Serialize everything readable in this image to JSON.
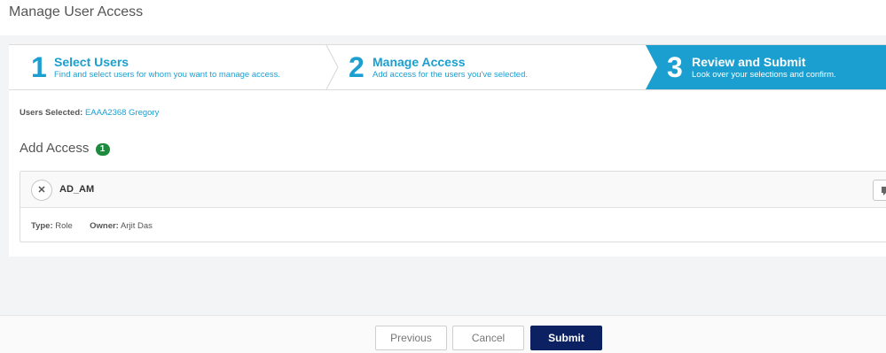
{
  "page": {
    "title": "Manage User Access"
  },
  "wizard": {
    "steps": [
      {
        "number": "1",
        "title": "Select Users",
        "description": "Find and select users for whom you want to manage access."
      },
      {
        "number": "2",
        "title": "Manage Access",
        "description": "Add access for the users you've selected."
      },
      {
        "number": "3",
        "title": "Review and Submit",
        "description": "Look over your selections and confirm."
      }
    ],
    "active_step": 3
  },
  "selection": {
    "label": "Users Selected:",
    "value": "EAAA2368 Gregory"
  },
  "add_access": {
    "heading": "Add Access",
    "count": "1",
    "items": [
      {
        "name": "AD_AM",
        "type_label": "Type:",
        "type": "Role",
        "owner_label": "Owner:",
        "owner": "Arjit Das"
      }
    ]
  },
  "footer": {
    "previous": "Previous",
    "cancel": "Cancel",
    "submit": "Submit"
  },
  "colors": {
    "accent": "#1a9fd0",
    "active_step_bg": "#1a9fd0",
    "badge": "#1e8a3e",
    "submit_bg": "#0b2161"
  },
  "icons": {
    "remove": "close-icon",
    "comment": "comment-icon"
  }
}
